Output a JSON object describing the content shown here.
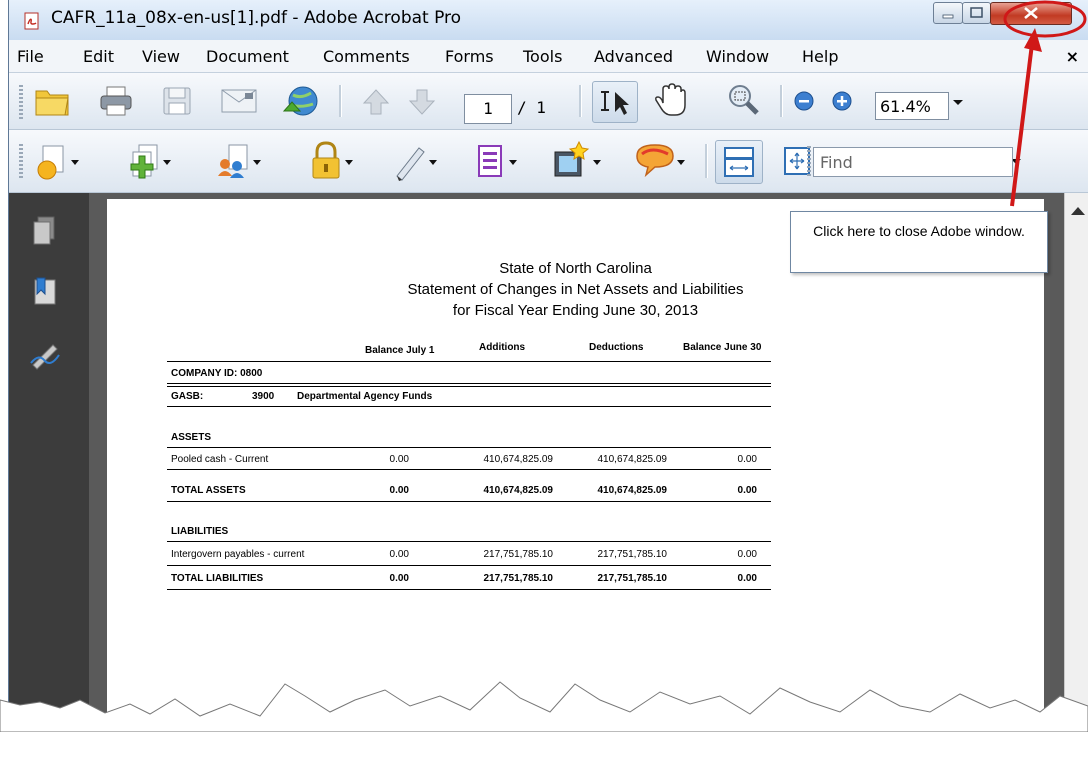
{
  "window": {
    "title": "CAFR_11a_08x-en-us[1].pdf - Adobe Acrobat Pro"
  },
  "menu": {
    "items": [
      "File",
      "Edit",
      "View",
      "Document",
      "Comments",
      "Forms",
      "Tools",
      "Advanced",
      "Window",
      "Help"
    ],
    "close_glyph": "×"
  },
  "toolbar": {
    "page_current": "1",
    "page_total": "/ 1",
    "zoom": "61.4%",
    "find_placeholder": "Find"
  },
  "icons": {
    "open": "folder-icon",
    "print": "printer-icon",
    "save": "floppy-icon",
    "email": "envelope-icon",
    "collaborate": "globe-arrow-icon",
    "prev_page": "up-arrow-icon",
    "next_page": "down-arrow-icon",
    "select": "text-select-icon",
    "hand": "hand-icon",
    "zoom_tool": "magnifier-icon",
    "zoom_out": "minus-icon",
    "zoom_in": "plus-icon",
    "create": "create-pdf-icon",
    "combine": "combine-icon",
    "collaborate2": "people-icon",
    "secure": "lock-icon",
    "sign": "pen-icon",
    "forms": "form-icon",
    "multimedia": "film-icon",
    "comment": "speech-bubble-icon",
    "fit_width": "fit-width-icon",
    "fit_page": "fit-page-icon",
    "pages_panel": "pages-icon",
    "bookmarks": "bookmark-icon",
    "signatures": "signature-icon"
  },
  "document": {
    "title1": "State of North Carolina",
    "title2": "Statement of Changes in Net Assets and Liabilities",
    "title3": "for Fiscal Year Ending June 30, 2013",
    "columns": [
      "Balance July 1",
      "Additions",
      "Deductions",
      "Balance June 30"
    ],
    "company": "COMPANY ID: 0800",
    "gasb_label": "GASB:",
    "gasb_code": "3900",
    "gasb_name": "Departmental Agency Funds",
    "assets_heading": "ASSETS",
    "assets_rows": [
      {
        "label": "Pooled cash - Current",
        "values": [
          "0.00",
          "410,674,825.09",
          "410,674,825.09",
          "0.00"
        ]
      },
      {
        "label": "TOTAL ASSETS",
        "values": [
          "0.00",
          "410,674,825.09",
          "410,674,825.09",
          "0.00"
        ]
      }
    ],
    "liabilities_heading": "LIABILITIES",
    "liabilities_rows": [
      {
        "label": "Intergovern payables - current",
        "values": [
          "0.00",
          "217,751,785.10",
          "217,751,785.10",
          "0.00"
        ]
      },
      {
        "label": "TOTAL LIABILITIES",
        "values": [
          "0.00",
          "217,751,785.10",
          "217,751,785.10",
          "0.00"
        ]
      }
    ]
  },
  "callout": {
    "text": "Click here to close Adobe window."
  },
  "colors": {
    "close_button": "#c13a23",
    "annotation": "#d01818",
    "sidebar": "#3c3c3c"
  }
}
